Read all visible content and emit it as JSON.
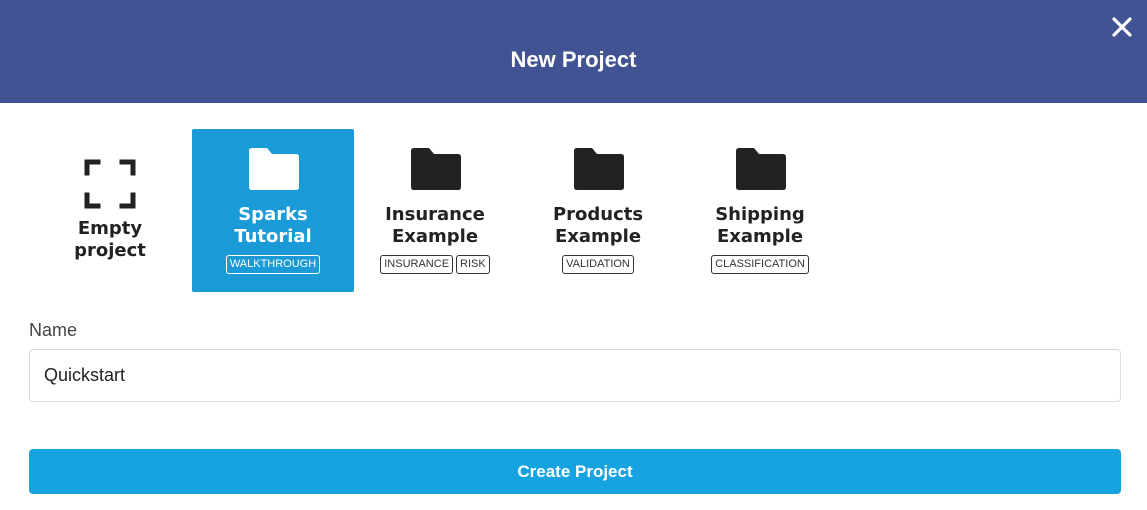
{
  "dialog": {
    "title": "New Project",
    "close_icon": "close-icon"
  },
  "templates": [
    {
      "label_line1": "Empty",
      "label_line2": "project",
      "icon": "expand-frame-icon",
      "tags": [],
      "selected": false
    },
    {
      "label_line1": "Sparks",
      "label_line2": "Tutorial",
      "icon": "folder-icon",
      "tags": [
        "WALKTHROUGH"
      ],
      "selected": true
    },
    {
      "label_line1": "Insurance",
      "label_line2": "Example",
      "icon": "folder-icon",
      "tags": [
        "INSURANCE",
        "RISK"
      ],
      "selected": false
    },
    {
      "label_line1": "Products",
      "label_line2": "Example",
      "icon": "folder-icon",
      "tags": [
        "VALIDATION"
      ],
      "selected": false
    },
    {
      "label_line1": "Shipping",
      "label_line2": "Example",
      "icon": "folder-icon",
      "tags": [
        "CLASSIFICATION"
      ],
      "selected": false
    }
  ],
  "form": {
    "name_label": "Name",
    "name_value": "Quickstart"
  },
  "actions": {
    "create_label": "Create Project"
  },
  "colors": {
    "header": "#425394",
    "selected_card": "#1a9ad6",
    "primary_button": "#17a2e0"
  }
}
